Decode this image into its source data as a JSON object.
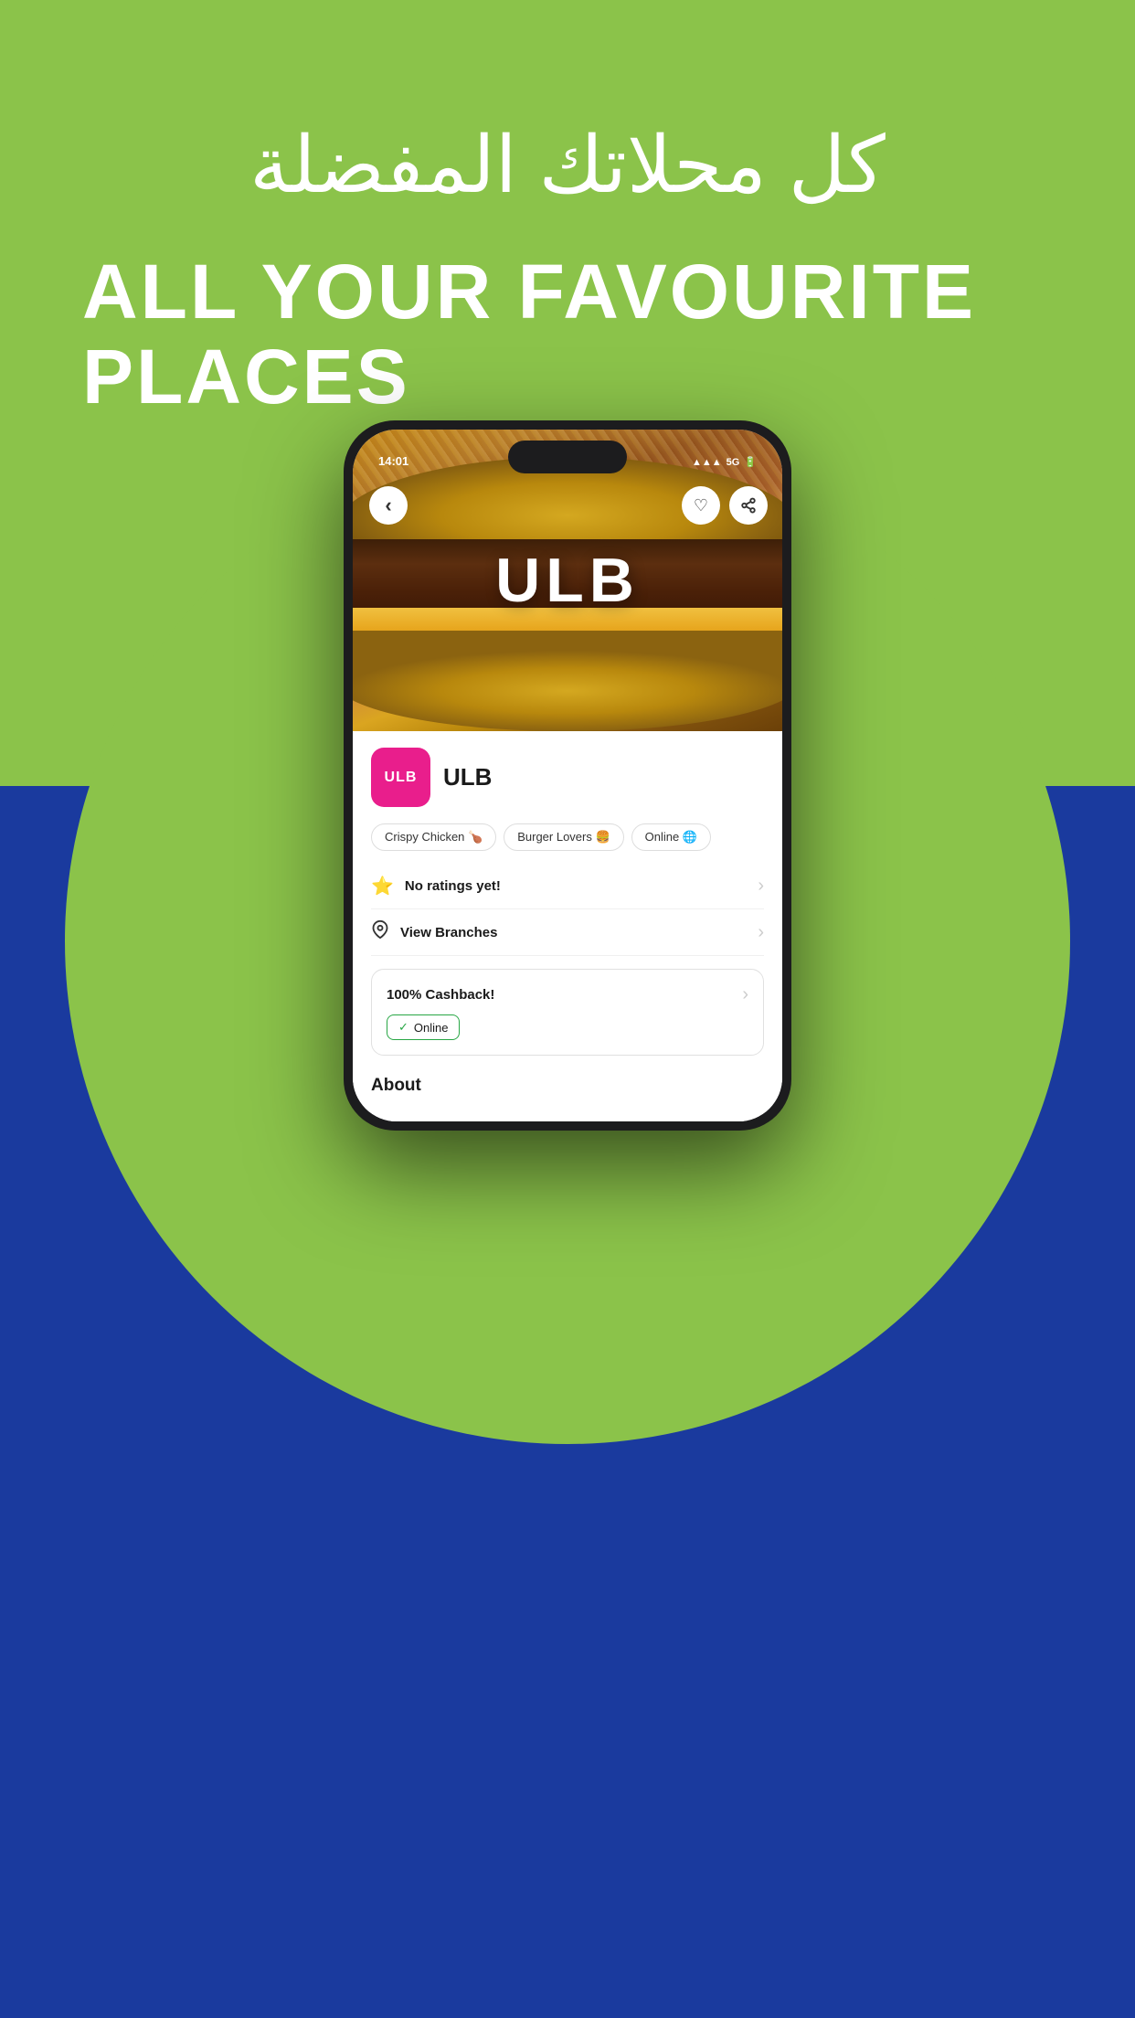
{
  "background": {
    "top_color": "#8bc34a",
    "bottom_color": "#1a3a9e"
  },
  "header": {
    "arabic_title": "كل محلاتك المفضلة",
    "english_title_line1": "ALL YOUR FAVOURITE",
    "english_title_line2": "PLACES"
  },
  "phone": {
    "status_bar": {
      "time": "14:01",
      "signal": "5G"
    },
    "hero": {
      "brand_text": "ULB"
    },
    "brand": {
      "logo_text": "ULB",
      "name": "ULB"
    },
    "tags": [
      {
        "label": "Crispy Chicken 🍗"
      },
      {
        "label": "Burger Lovers 🍔"
      },
      {
        "label": "Online 🌐"
      }
    ],
    "ratings": {
      "text": "No ratings yet!",
      "icon": "⭐"
    },
    "branches": {
      "text": "View Branches",
      "icon": "📍"
    },
    "cashback": {
      "title": "100% Cashback!",
      "badge_text": "Online",
      "chevron": "›"
    },
    "about": {
      "title": "About"
    },
    "buttons": {
      "back": "‹",
      "heart": "♡",
      "share": "⤴"
    }
  }
}
